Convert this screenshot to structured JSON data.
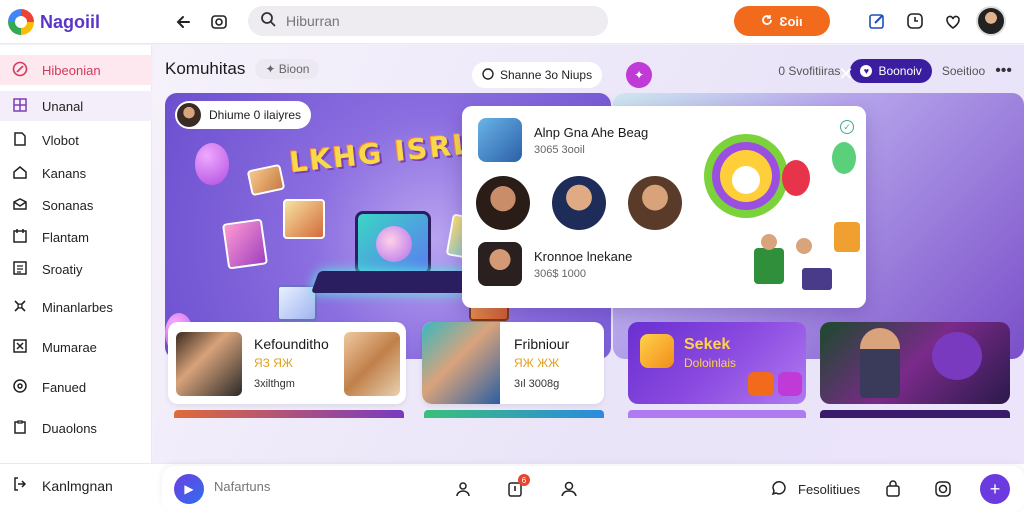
{
  "app": {
    "name": "Nagoiil"
  },
  "header": {
    "search_placeholder": "Hiburran",
    "cta_label": "Ɛoiι",
    "cta_icon": "refresh-icon",
    "icons": [
      "back-arrow-icon",
      "camera-icon",
      "edit-icon",
      "clock-icon",
      "heart-pin-icon"
    ]
  },
  "sidebar": {
    "items": [
      {
        "label": "Hibeonian",
        "icon": "target-icon",
        "active": true
      },
      {
        "label": "Unanal",
        "icon": "grid-icon"
      },
      {
        "label": "Vlobot",
        "icon": "document-icon"
      },
      {
        "label": "Kanans",
        "icon": "home-icon"
      },
      {
        "label": "Sonanas",
        "icon": "mail-icon"
      },
      {
        "label": "Flantam",
        "icon": "calendar-icon"
      },
      {
        "label": "Sroatiy",
        "icon": "list-icon"
      },
      {
        "label": "Minanlarbes",
        "icon": "tools-icon"
      },
      {
        "label": "Mumarae",
        "icon": "close-box-icon"
      },
      {
        "label": "Fanued",
        "icon": "settings-circle-icon"
      },
      {
        "label": "Duaolons",
        "icon": "clipboard-icon"
      }
    ],
    "footer_label": "Kanlmgnan"
  },
  "main": {
    "title": "Komuhitas",
    "title_chip": "Bioon",
    "actions": {
      "status": "0 Svofitiiras",
      "primary": "Boonoiv",
      "secondary": "Soeitioo"
    }
  },
  "hero": {
    "chip_label": "Dhiume 0 ilaiyres",
    "headline": "LKHG ISRLIVAI"
  },
  "panel": {
    "chip_label": "Shanne 3o Niups",
    "rows": [
      {
        "name": "Alnp Gna Ahe Beag",
        "meta": "3065 3ooil"
      },
      {
        "name": "Kronnoe lnekane",
        "meta": "306$ 1000"
      }
    ]
  },
  "cards": [
    {
      "title": "Kefounditho",
      "sub": "ЯЗ ЯЖ",
      "meta": "3xilthgm"
    },
    {
      "title": "Fribniour",
      "sub": "ЯЖ ЖЖ",
      "meta": "3ıl 3008g"
    },
    {
      "title": "Sekek",
      "sub": "Doloinlais"
    }
  ],
  "bottombar": {
    "composer_placeholder": "Nafartuns",
    "features_label": "Fesolitiues",
    "notification_count": "6"
  },
  "colors": {
    "brand": "#5a36c8",
    "cta": "#f26b1d",
    "active": "#d23a5a",
    "primary_pill": "#3b1ea0"
  }
}
